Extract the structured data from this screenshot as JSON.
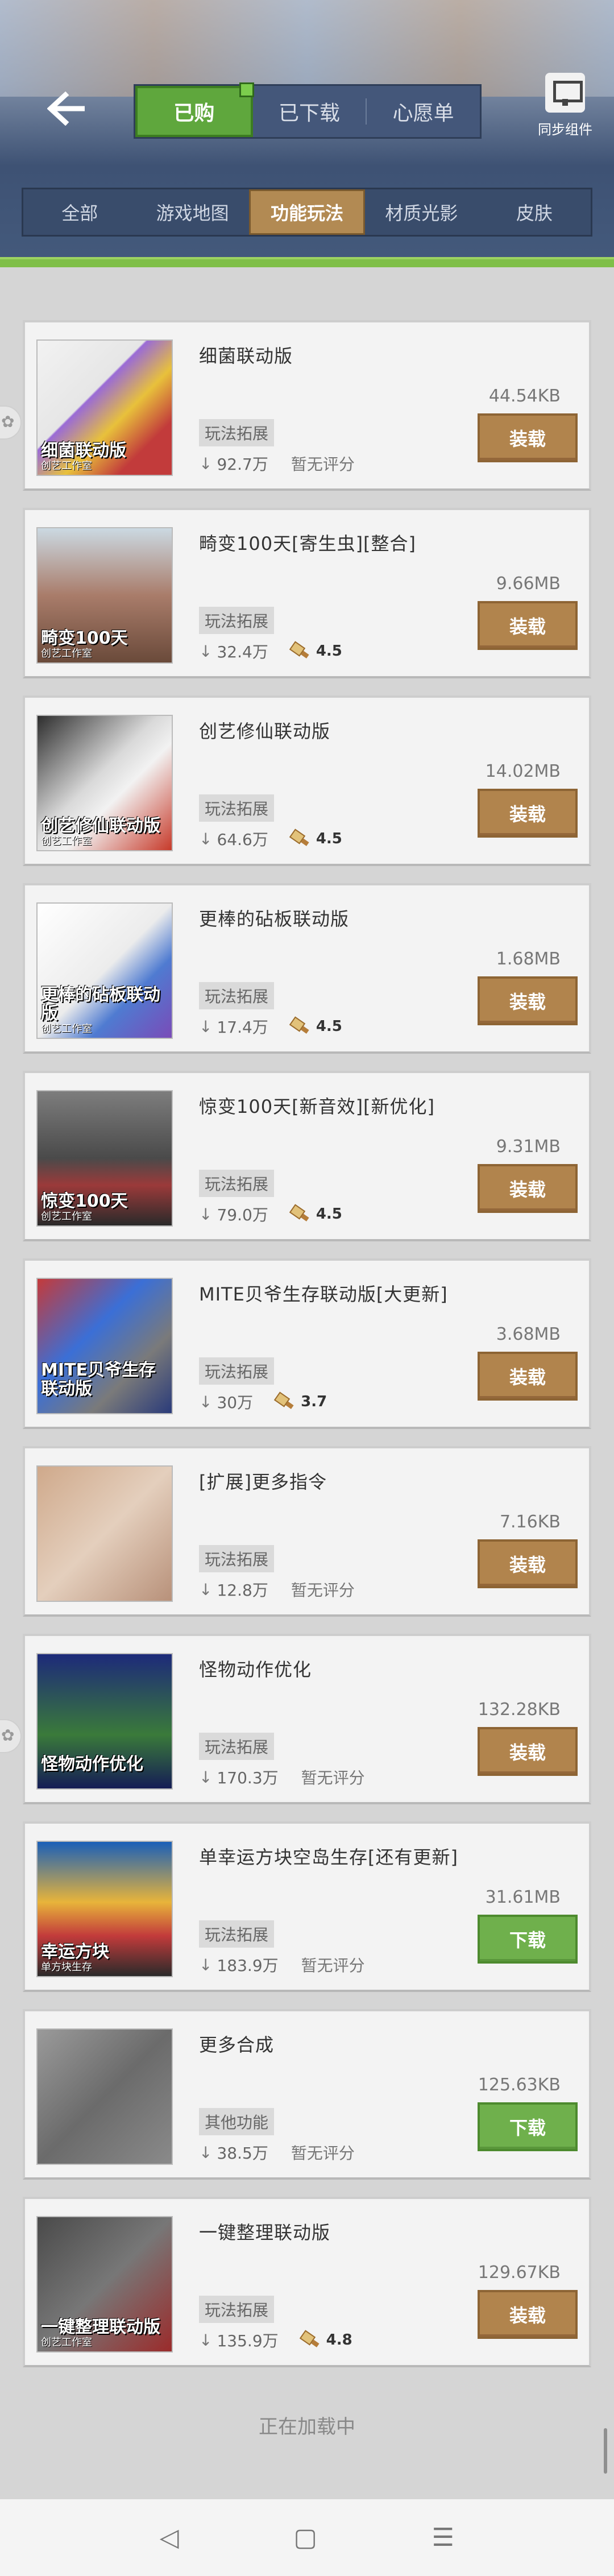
{
  "header": {
    "back_icon": "arrow-left-icon",
    "segments": [
      "已购",
      "已下载",
      "心愿单"
    ],
    "active_segment": "已购",
    "sync_label": "同步组件",
    "sync_icon": "computer-sync-icon"
  },
  "categories": {
    "items": [
      "全部",
      "游戏地图",
      "功能玩法",
      "材质光影",
      "皮肤"
    ],
    "active": "功能玩法"
  },
  "items": [
    {
      "title": "细菌联动版",
      "size": "44.54KB",
      "tag": "玩法拓展",
      "downloads": "92.7万",
      "rating": "暂无评分",
      "button": "装载",
      "thumb_caption": "细菌联动版",
      "thumb_sub": "创艺工作室"
    },
    {
      "title": "畸变100天[寄生虫][整合]",
      "size": "9.66MB",
      "tag": "玩法拓展",
      "downloads": "32.4万",
      "rating": "4.5",
      "button": "装载",
      "thumb_caption": "畸变100天",
      "thumb_sub": "创艺工作室"
    },
    {
      "title": "创艺修仙联动版",
      "size": "14.02MB",
      "tag": "玩法拓展",
      "downloads": "64.6万",
      "rating": "4.5",
      "button": "装载",
      "thumb_caption": "创艺修仙联动版",
      "thumb_sub": "创艺工作室"
    },
    {
      "title": "更棒的砧板联动版",
      "size": "1.68MB",
      "tag": "玩法拓展",
      "downloads": "17.4万",
      "rating": "4.5",
      "button": "装载",
      "thumb_caption": "更棒的砧板联动版",
      "thumb_sub": "创艺工作室"
    },
    {
      "title": "惊变100天[新音效][新优化]",
      "size": "9.31MB",
      "tag": "玩法拓展",
      "downloads": "79.0万",
      "rating": "4.5",
      "button": "装载",
      "thumb_caption": "惊变100天",
      "thumb_sub": "创艺工作室"
    },
    {
      "title": "MITE贝爷生存联动版[大更新]",
      "size": "3.68MB",
      "tag": "玩法拓展",
      "downloads": "30万",
      "rating": "3.7",
      "button": "装载",
      "thumb_caption": "MITE贝爷生存联动版",
      "thumb_sub": ""
    },
    {
      "title": "[扩展]更多指令",
      "size": "7.16KB",
      "tag": "玩法拓展",
      "downloads": "12.8万",
      "rating": "暂无评分",
      "button": "装载",
      "thumb_caption": "",
      "thumb_sub": ""
    },
    {
      "title": "怪物动作优化",
      "size": "132.28KB",
      "tag": "玩法拓展",
      "downloads": "170.3万",
      "rating": "暂无评分",
      "button": "装载",
      "thumb_caption": "怪物动作优化",
      "thumb_sub": ""
    },
    {
      "title": "单幸运方块空岛生存[还有更新]",
      "size": "31.61MB",
      "tag": "玩法拓展",
      "downloads": "183.9万",
      "rating": "暂无评分",
      "button": "下载",
      "thumb_caption": "幸运方块",
      "thumb_sub": "单方块生存"
    },
    {
      "title": "更多合成",
      "size": "125.63KB",
      "tag": "其他功能",
      "downloads": "38.5万",
      "rating": "暂无评分",
      "button": "下载",
      "thumb_caption": "",
      "thumb_sub": ""
    },
    {
      "title": "一键整理联动版",
      "size": "129.67KB",
      "tag": "玩法拓展",
      "downloads": "135.9万",
      "rating": "4.8",
      "button": "装载",
      "thumb_caption": "一键整理联动版",
      "thumb_sub": "创艺工作室"
    }
  ],
  "footer": {
    "loading_text": "正在加载中"
  },
  "navbar": {
    "back": "◁",
    "home": "▢",
    "menu": "☰"
  }
}
